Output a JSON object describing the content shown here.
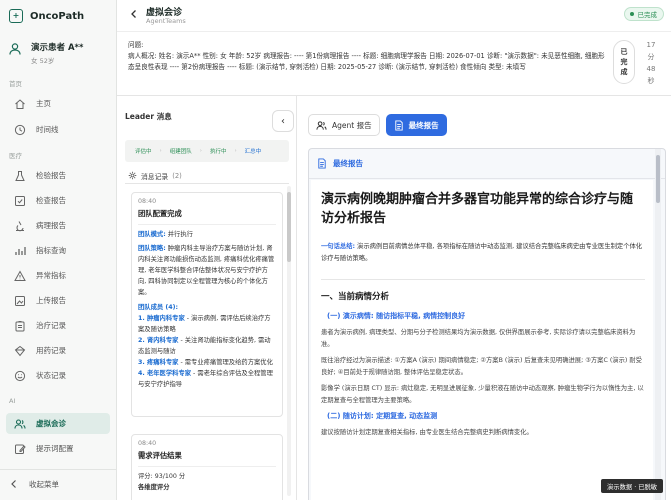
{
  "sidebar": {
    "brand_name": "OncoPath",
    "brand_logo_char": "+",
    "patient_name": "演示患者 A**",
    "patient_info": "女 52岁",
    "sections": {
      "home": "首页",
      "medical": "医疗",
      "ai": "AI"
    },
    "items": [
      {
        "label": "主页",
        "icon": "home-icon"
      },
      {
        "label": "时间线",
        "icon": "clock-icon"
      },
      {
        "label": "检验报告",
        "icon": "flask-icon"
      },
      {
        "label": "检查报告",
        "icon": "scan-icon"
      },
      {
        "label": "病理报告",
        "icon": "microscope-icon"
      },
      {
        "label": "指标查询",
        "icon": "chart-icon"
      },
      {
        "label": "异常指标",
        "icon": "alert-icon"
      },
      {
        "label": "上传报告",
        "icon": "upload-icon"
      },
      {
        "label": "治疗记录",
        "icon": "clipboard-icon"
      },
      {
        "label": "用药记录",
        "icon": "pill-icon"
      },
      {
        "label": "状态记录",
        "icon": "smile-icon"
      },
      {
        "label": "虚拟会诊",
        "icon": "team-icon",
        "active": true
      },
      {
        "label": "提示词配置",
        "icon": "edit-icon"
      }
    ],
    "collapse_label": "收起菜单"
  },
  "header": {
    "title": "虚拟会诊",
    "subtitle": "AgentTeams",
    "status_badge": "已完成"
  },
  "info": {
    "question_label": "问题:",
    "overview": "病人概况: 姓名: 演示A** 性别: 女 年龄: 52岁 病理报告: ---- 第1份病理报告 ---- 标题: 细胞病理学报告 日期: 2026-07-01 诊断: \"演示数据\": 未见恶性细胞, 细胞形态呈良性表现 ---- 第2份病理报告 ---- 标题: (演示结节, 穿刺活检) 日期: 2025-05-27 诊断: (演示结节, 穿刺活检) 食性倾向 类型: 未填写",
    "status_pill": "已完成",
    "elapsed": "17分48秒"
  },
  "leader": {
    "title": "Leader 消息",
    "collapse_icon": "‹",
    "steps": [
      "评估中",
      "组建团队",
      "执行中",
      "汇总中"
    ],
    "messages_label": "消息记录",
    "messages_count": "(2)",
    "card1": {
      "time": "08:40",
      "title": "团队配置完成",
      "mode_label": "团队模式:",
      "mode_value": "并行执行",
      "strategy_label": "团队策略:",
      "strategy_text": "肿瘤内科主导治疗方案与随访计划, 肾内科关注肾功能损伤动态监测, 疼痛科优化疼痛管理, 老年医学科整合评估整体状况与安宁疗护方向, 四科协同制定以全程管理为核心的个体化方案。",
      "members_label": "团队成员 (4):",
      "m1_name": "1. 肿瘤内科专家",
      "m1_text": " - 演示病例, 需评估后续治疗方案及随访策略",
      "m2_name": "2. 肾内科专家",
      "m2_text": " - 关注肾功能指标变化趋势, 需动态监测与随访",
      "m3_name": "3. 疼痛科专家",
      "m3_text": " - 需专业疼痛管理及给药方案优化",
      "m4_name": "4. 老年医学科专家",
      "m4_text": " - 需老年综合评估及全程管理与安宁疗护指导"
    },
    "card2": {
      "time": "08:40",
      "title": "需求评估结果",
      "score": "评分: 93/100 分",
      "dims": "各维度评分"
    }
  },
  "tabs": {
    "agent_report": "Agent 报告",
    "final_report": "最终报告"
  },
  "report": {
    "header_label": "最终报告",
    "title": "演示病例晚期肿瘤合并多器官功能异常的综合诊疗与随访分析报告",
    "summary_label": "一句话总结:",
    "summary_text": "演示病例目前病情总体平稳, 各项指标在随访中动态监测, 建议结合完整临床病史由专业医生制定个体化诊疗与随访策略。",
    "h2_1": "一、当前病情分析",
    "h3_1": "(一) 演示病情: 随访指标平稳, 病情控制良好",
    "p1": "患者为演示病例, 病理类型、分期与分子检测结果均为演示数据, 仅供界面展示参考, 实际诊疗请以完整临床资料为准。",
    "p2": "既往治疗经过为演示描述: ①方案A (演示) 期间病情稳定; ②方案B (演示) 后复查未见明确进展; ③方案C (演示) 耐受良好; ④目前处于规律随访期, 整体评估呈稳定状态。",
    "p3": "影像学 (演示日期 CT) 显示: 病灶稳定, 无明显进展征象, 少量积液在随访中动态观察, 肿瘤生物学行为以惰性为主, 以定期复查与全程管理为主要策略。",
    "h3_2": "(二) 随访计划: 定期复查, 动态监测",
    "p4": "建议按随访计划定期复查相关指标, 由专业医生结合完整病史判断病情变化。"
  },
  "floating_badge": "演示数据 · 已脱敏",
  "colors": {
    "brand": "#1a6b57",
    "accent_blue": "#2f6be0",
    "success": "#2c8f56"
  }
}
